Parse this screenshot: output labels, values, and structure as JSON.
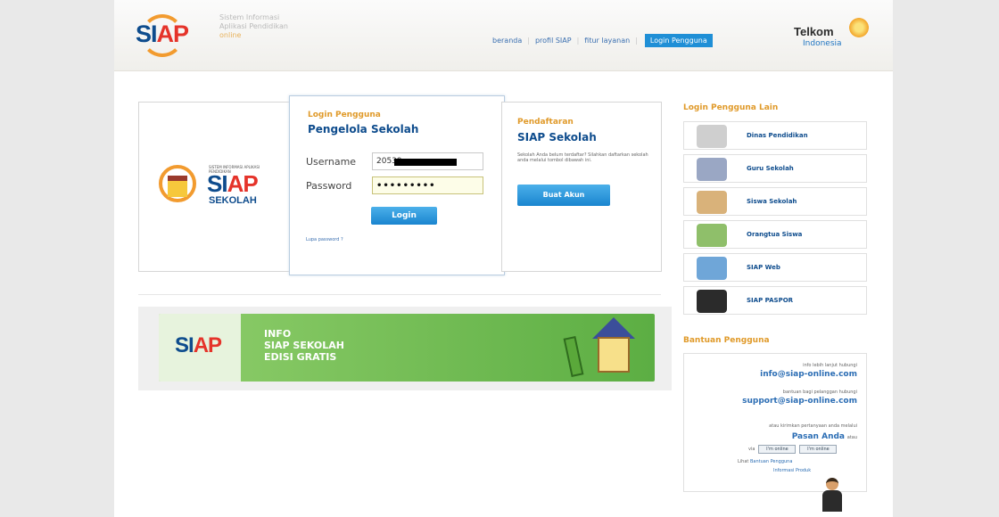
{
  "header": {
    "logo_text_main": "SI",
    "logo_text_accent": "AP",
    "tagline": [
      "Sistem Informasi",
      "Aplikasi Pendidikan"
    ],
    "tagline_sub": "online",
    "nav": [
      "beranda",
      "profil SIAP",
      "fitur layanan"
    ],
    "nav_button": "Login Pengguna",
    "partner_name": "Telkom",
    "partner_sub": "Indonesia"
  },
  "login": {
    "left_logo_small": "SISTEM INFORMASI APLIKASI PENDIDIKAN",
    "left_logo_main": "SI",
    "left_logo_accent": "AP",
    "left_logo_sub": "SEKOLAH",
    "title_small": "Login Pengguna",
    "title_big": "Pengelola Sekolah",
    "username_label": "Username",
    "username_value": "20539",
    "password_label": "Password",
    "password_value": "•••••••••",
    "login_button": "Login",
    "forgot": "Lupa password ?"
  },
  "register": {
    "title_small": "Pendaftaran",
    "title_big": "SIAP Sekolah",
    "desc": "Sekolah Anda belum terdaftar? Silahkan daftarkan sekolah anda melalui tombol dibawah ini.",
    "button": "Buat Akun"
  },
  "banner": {
    "logo_main": "SI",
    "logo_accent": "AP",
    "lines": [
      "INFO",
      "SIAP SEKOLAH",
      "EDISI GRATIS"
    ]
  },
  "sidebar": {
    "title": "Login Pengguna Lain",
    "items": [
      {
        "label": "Dinas Pendidikan",
        "color": "#b9b9b9"
      },
      {
        "label": "Guru Sekolah",
        "color": "#9aa7c4"
      },
      {
        "label": "Siswa Sekolah",
        "color": "#d9b27a"
      },
      {
        "label": "Orangtua Siswa",
        "color": "#8fbf6a"
      },
      {
        "label": "SIAP Web",
        "color": "#6fa6d8"
      },
      {
        "label": "SIAP PASPOR",
        "color": "#2b2b2b"
      }
    ],
    "help_title": "Bantuan Pengguna",
    "help": {
      "info_text": "info lebih lanjut hubungi",
      "info_email": "info@siap-online.com",
      "support_text": "bantuan bagi pelanggan hubungi",
      "support_email": "support@siap-online.com",
      "form_text": "atau kirimkan pertanyaan anda melalui",
      "form_link": "Pasan Anda",
      "form_suffix": "atau",
      "ym_prefix": "via",
      "ym_1": "I'm online",
      "ym_2": "I'm online",
      "links_prefix": "Lihat",
      "link_1": "Bantuan Pengguna",
      "link_2": "Informasi Produk"
    }
  }
}
